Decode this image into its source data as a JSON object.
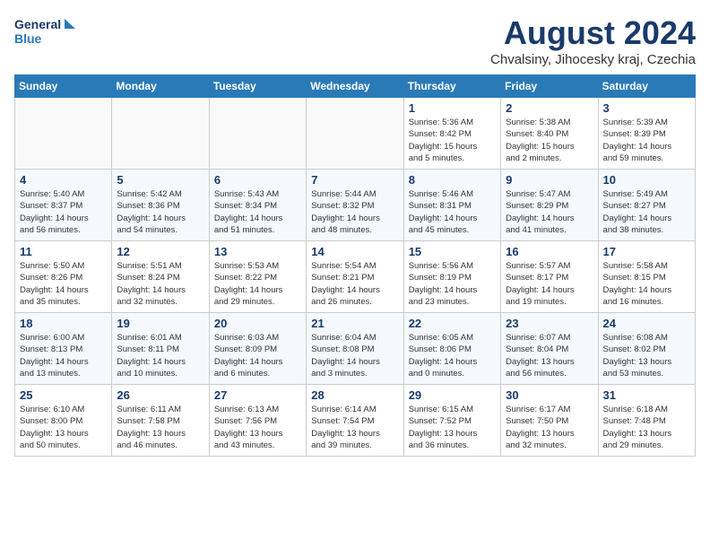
{
  "header": {
    "logo_line1": "General",
    "logo_line2": "Blue",
    "month_title": "August 2024",
    "subtitle": "Chvalsiny, Jihocesky kraj, Czechia"
  },
  "weekdays": [
    "Sunday",
    "Monday",
    "Tuesday",
    "Wednesday",
    "Thursday",
    "Friday",
    "Saturday"
  ],
  "weeks": [
    [
      {
        "day": "",
        "info": ""
      },
      {
        "day": "",
        "info": ""
      },
      {
        "day": "",
        "info": ""
      },
      {
        "day": "",
        "info": ""
      },
      {
        "day": "1",
        "info": "Sunrise: 5:36 AM\nSunset: 8:42 PM\nDaylight: 15 hours\nand 5 minutes."
      },
      {
        "day": "2",
        "info": "Sunrise: 5:38 AM\nSunset: 8:40 PM\nDaylight: 15 hours\nand 2 minutes."
      },
      {
        "day": "3",
        "info": "Sunrise: 5:39 AM\nSunset: 8:39 PM\nDaylight: 14 hours\nand 59 minutes."
      }
    ],
    [
      {
        "day": "4",
        "info": "Sunrise: 5:40 AM\nSunset: 8:37 PM\nDaylight: 14 hours\nand 56 minutes."
      },
      {
        "day": "5",
        "info": "Sunrise: 5:42 AM\nSunset: 8:36 PM\nDaylight: 14 hours\nand 54 minutes."
      },
      {
        "day": "6",
        "info": "Sunrise: 5:43 AM\nSunset: 8:34 PM\nDaylight: 14 hours\nand 51 minutes."
      },
      {
        "day": "7",
        "info": "Sunrise: 5:44 AM\nSunset: 8:32 PM\nDaylight: 14 hours\nand 48 minutes."
      },
      {
        "day": "8",
        "info": "Sunrise: 5:46 AM\nSunset: 8:31 PM\nDaylight: 14 hours\nand 45 minutes."
      },
      {
        "day": "9",
        "info": "Sunrise: 5:47 AM\nSunset: 8:29 PM\nDaylight: 14 hours\nand 41 minutes."
      },
      {
        "day": "10",
        "info": "Sunrise: 5:49 AM\nSunset: 8:27 PM\nDaylight: 14 hours\nand 38 minutes."
      }
    ],
    [
      {
        "day": "11",
        "info": "Sunrise: 5:50 AM\nSunset: 8:26 PM\nDaylight: 14 hours\nand 35 minutes."
      },
      {
        "day": "12",
        "info": "Sunrise: 5:51 AM\nSunset: 8:24 PM\nDaylight: 14 hours\nand 32 minutes."
      },
      {
        "day": "13",
        "info": "Sunrise: 5:53 AM\nSunset: 8:22 PM\nDaylight: 14 hours\nand 29 minutes."
      },
      {
        "day": "14",
        "info": "Sunrise: 5:54 AM\nSunset: 8:21 PM\nDaylight: 14 hours\nand 26 minutes."
      },
      {
        "day": "15",
        "info": "Sunrise: 5:56 AM\nSunset: 8:19 PM\nDaylight: 14 hours\nand 23 minutes."
      },
      {
        "day": "16",
        "info": "Sunrise: 5:57 AM\nSunset: 8:17 PM\nDaylight: 14 hours\nand 19 minutes."
      },
      {
        "day": "17",
        "info": "Sunrise: 5:58 AM\nSunset: 8:15 PM\nDaylight: 14 hours\nand 16 minutes."
      }
    ],
    [
      {
        "day": "18",
        "info": "Sunrise: 6:00 AM\nSunset: 8:13 PM\nDaylight: 14 hours\nand 13 minutes."
      },
      {
        "day": "19",
        "info": "Sunrise: 6:01 AM\nSunset: 8:11 PM\nDaylight: 14 hours\nand 10 minutes."
      },
      {
        "day": "20",
        "info": "Sunrise: 6:03 AM\nSunset: 8:09 PM\nDaylight: 14 hours\nand 6 minutes."
      },
      {
        "day": "21",
        "info": "Sunrise: 6:04 AM\nSunset: 8:08 PM\nDaylight: 14 hours\nand 3 minutes."
      },
      {
        "day": "22",
        "info": "Sunrise: 6:05 AM\nSunset: 8:06 PM\nDaylight: 14 hours\nand 0 minutes."
      },
      {
        "day": "23",
        "info": "Sunrise: 6:07 AM\nSunset: 8:04 PM\nDaylight: 13 hours\nand 56 minutes."
      },
      {
        "day": "24",
        "info": "Sunrise: 6:08 AM\nSunset: 8:02 PM\nDaylight: 13 hours\nand 53 minutes."
      }
    ],
    [
      {
        "day": "25",
        "info": "Sunrise: 6:10 AM\nSunset: 8:00 PM\nDaylight: 13 hours\nand 50 minutes."
      },
      {
        "day": "26",
        "info": "Sunrise: 6:11 AM\nSunset: 7:58 PM\nDaylight: 13 hours\nand 46 minutes."
      },
      {
        "day": "27",
        "info": "Sunrise: 6:13 AM\nSunset: 7:56 PM\nDaylight: 13 hours\nand 43 minutes."
      },
      {
        "day": "28",
        "info": "Sunrise: 6:14 AM\nSunset: 7:54 PM\nDaylight: 13 hours\nand 39 minutes."
      },
      {
        "day": "29",
        "info": "Sunrise: 6:15 AM\nSunset: 7:52 PM\nDaylight: 13 hours\nand 36 minutes."
      },
      {
        "day": "30",
        "info": "Sunrise: 6:17 AM\nSunset: 7:50 PM\nDaylight: 13 hours\nand 32 minutes."
      },
      {
        "day": "31",
        "info": "Sunrise: 6:18 AM\nSunset: 7:48 PM\nDaylight: 13 hours\nand 29 minutes."
      }
    ]
  ]
}
